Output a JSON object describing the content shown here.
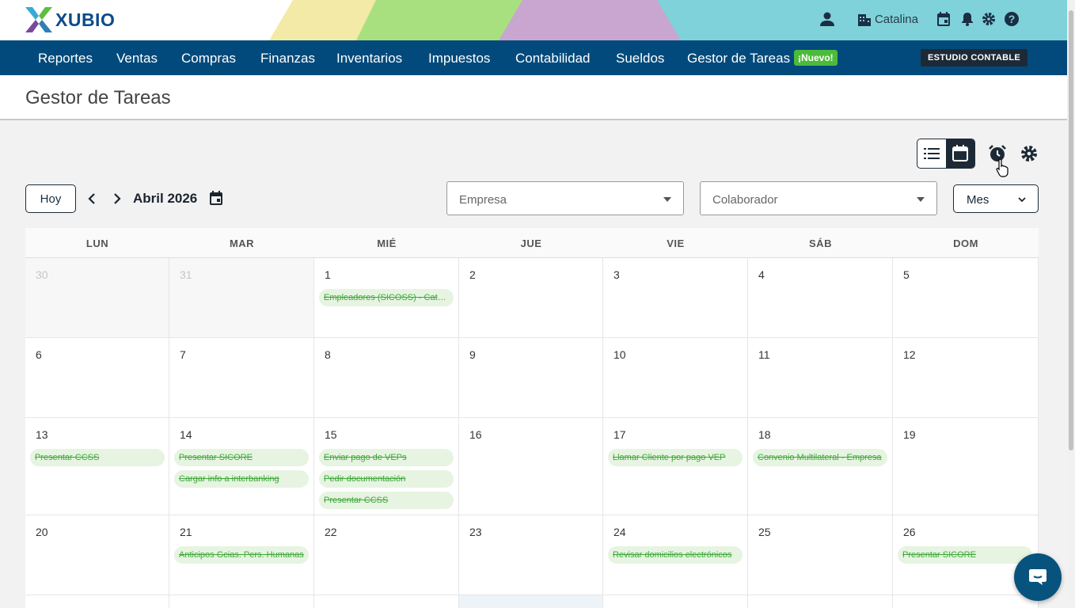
{
  "header": {
    "brand": "XUBIO",
    "user_name": "Catalina",
    "icons": [
      "user-icon",
      "building-icon",
      "calendar-icon",
      "bell-icon",
      "gear-icon",
      "help-icon"
    ]
  },
  "nav": {
    "items": [
      "Reportes",
      "Ventas",
      "Compras",
      "Finanzas",
      "Inventarios",
      "Impuestos",
      "Contabilidad",
      "Sueldos",
      "Gestor de Tareas"
    ],
    "new_badge": "¡Nuevo!",
    "studio_button": "ESTUDIO CONTABLE"
  },
  "page": {
    "title": "Gestor de Tareas"
  },
  "toolbar": {
    "today_button": "Hoy",
    "month_label": "Abril 2026",
    "empresa_placeholder": "Empresa",
    "colaborador_placeholder": "Colaborador",
    "view_select": "Mes"
  },
  "calendar": {
    "day_headers": [
      "LUN",
      "MAR",
      "MIÉ",
      "JUE",
      "VIE",
      "SÁB",
      "DOM"
    ],
    "weeks": [
      [
        {
          "day": "30",
          "other": true,
          "tasks": []
        },
        {
          "day": "31",
          "other": true,
          "tasks": []
        },
        {
          "day": "1",
          "tasks": [
            "Empleadores (SICOSS) - Catalina"
          ]
        },
        {
          "day": "2",
          "tasks": []
        },
        {
          "day": "3",
          "tasks": []
        },
        {
          "day": "4",
          "tasks": []
        },
        {
          "day": "5",
          "tasks": []
        }
      ],
      [
        {
          "day": "6",
          "tasks": []
        },
        {
          "day": "7",
          "tasks": []
        },
        {
          "day": "8",
          "tasks": []
        },
        {
          "day": "9",
          "tasks": []
        },
        {
          "day": "10",
          "tasks": []
        },
        {
          "day": "11",
          "tasks": []
        },
        {
          "day": "12",
          "tasks": []
        }
      ],
      [
        {
          "day": "13",
          "tasks": [
            "Presentar CCSS"
          ]
        },
        {
          "day": "14",
          "tasks": [
            "Presentar SICORE",
            "Cargar info a interbanking"
          ]
        },
        {
          "day": "15",
          "tasks": [
            "Enviar pago de VEPs",
            "Pedir documentación",
            "Presentar CCSS"
          ]
        },
        {
          "day": "16",
          "tasks": []
        },
        {
          "day": "17",
          "tasks": [
            "Llamar Cliente por pago VEP"
          ]
        },
        {
          "day": "18",
          "tasks": [
            "Convenio Multilateral - Empresa"
          ]
        },
        {
          "day": "19",
          "tasks": []
        }
      ],
      [
        {
          "day": "20",
          "tasks": []
        },
        {
          "day": "21",
          "tasks": [
            "Anticipos Gcias. Pers. Humanas"
          ]
        },
        {
          "day": "22",
          "tasks": []
        },
        {
          "day": "23",
          "tasks": []
        },
        {
          "day": "24",
          "tasks": [
            "Revisar domicilios electrónicos"
          ]
        },
        {
          "day": "25",
          "tasks": []
        },
        {
          "day": "26",
          "tasks": [
            "Presentar SICORE"
          ]
        }
      ]
    ]
  }
}
